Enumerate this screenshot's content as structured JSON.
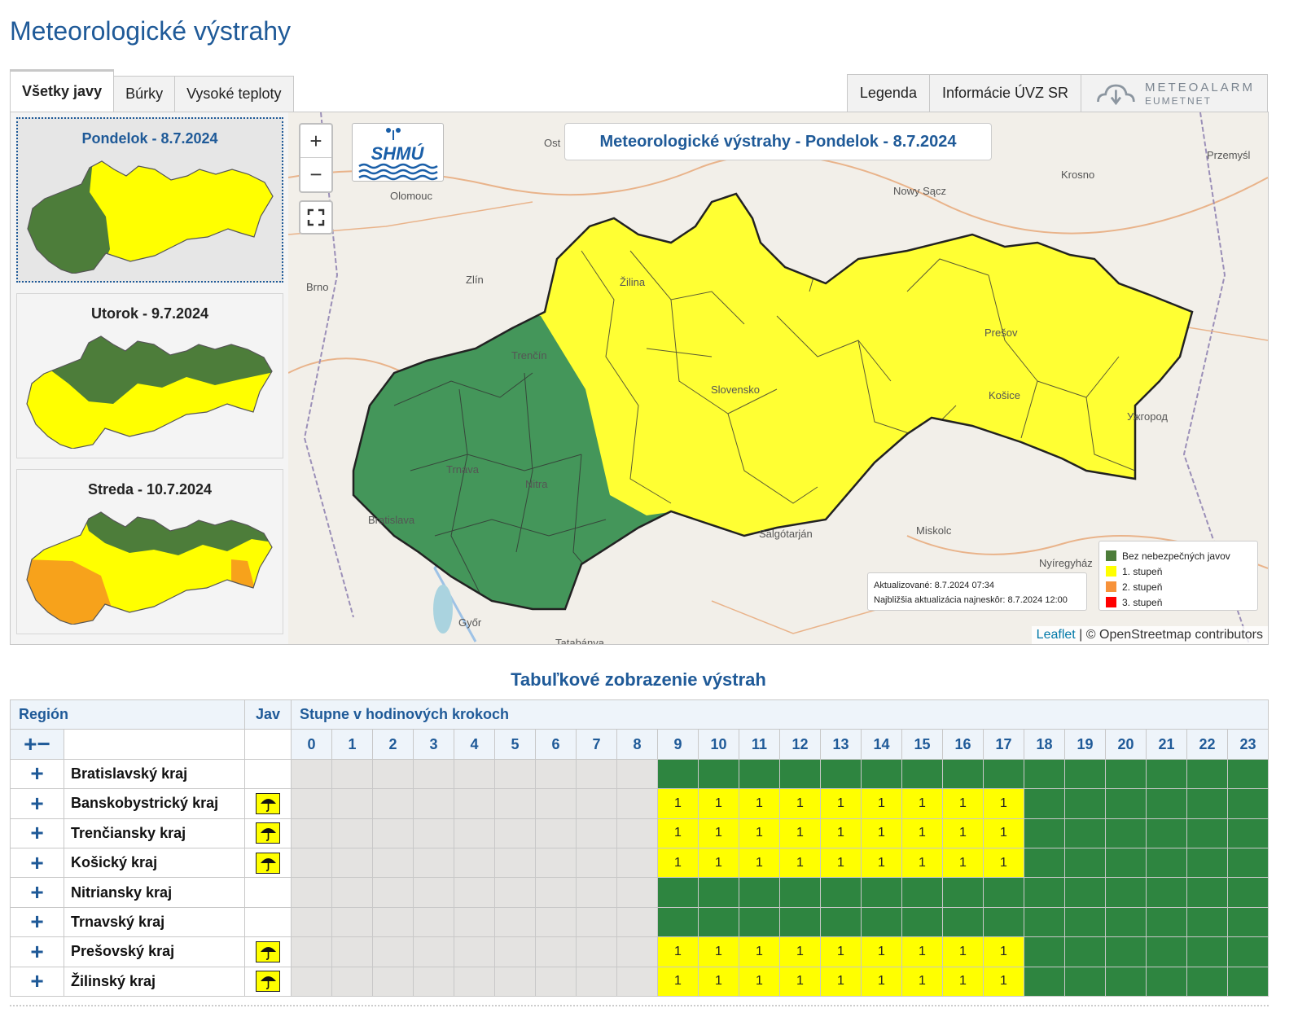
{
  "page": {
    "title": "Meteorologické výstrahy"
  },
  "tabs": [
    {
      "label": "Všetky javy",
      "active": true
    },
    {
      "label": "Búrky",
      "active": false
    },
    {
      "label": "Vysoké teploty",
      "active": false
    }
  ],
  "right_tabs": {
    "legend": "Legenda",
    "info": "Informácie ÚVZ SR",
    "meteoalarm_1": "METEOALARM",
    "meteoalarm_2": "EUMETNET"
  },
  "days": [
    {
      "label": "Pondelok - 8.7.2024",
      "selected": true
    },
    {
      "label": "Utorok - 9.7.2024",
      "selected": false
    },
    {
      "label": "Streda - 10.7.2024",
      "selected": false
    }
  ],
  "map": {
    "title": "Meteorologické výstrahy - Pondelok - 8.7.2024",
    "logo_text": "SHMÚ",
    "zoom_in": "+",
    "zoom_out": "−",
    "updated": "Aktualizované: 8.7.2024 07:34",
    "next_update": "Najbližšia aktualizácia najneskôr: 8.7.2024 12:00",
    "attribution_leaflet": "Leaflet",
    "attribution_rest": " | © OpenStreetmap contributors",
    "places": [
      "Olomouc",
      "Zlín",
      "Brno",
      "Trenčín",
      "Žilina",
      "Trnava",
      "Nitra",
      "Bratislava",
      "Slovensko",
      "Prešov",
      "Košice",
      "Ужгород",
      "Nowy Sącz",
      "Krosno",
      "Przemyśl",
      "Salgótarján",
      "Miskolc",
      "Nyíregyház",
      "Győr",
      "Tatabánya",
      "Ost"
    ]
  },
  "legend": [
    {
      "label": "Bez nebezpečných javov",
      "color": "#2e8540"
    },
    {
      "label": "1. stupeň",
      "color": "#ffff00"
    },
    {
      "label": "2. stupeň",
      "color": "#f7923a"
    },
    {
      "label": "3. stupeň",
      "color": "#ff0000"
    }
  ],
  "table": {
    "title": "Tabuľkové zobrazenie výstrah",
    "col_region": "Región",
    "col_jav": "Jav",
    "col_steps": "Stupne v hodinových krokoch",
    "expand_collapse": "+−",
    "hours": [
      "0",
      "1",
      "2",
      "3",
      "4",
      "5",
      "6",
      "7",
      "8",
      "9",
      "10",
      "11",
      "12",
      "13",
      "14",
      "15",
      "16",
      "17",
      "18",
      "19",
      "20",
      "21",
      "22",
      "23"
    ],
    "rows": [
      {
        "region": "Bratislavský kraj",
        "jav": false,
        "level": 0
      },
      {
        "region": "Banskobystrický kraj",
        "jav": true,
        "level": 1
      },
      {
        "region": "Trenčiansky kraj",
        "jav": true,
        "level": 1
      },
      {
        "region": "Košický kraj",
        "jav": true,
        "level": 1
      },
      {
        "region": "Nitriansky kraj",
        "jav": false,
        "level": 0
      },
      {
        "region": "Trnavský kraj",
        "jav": false,
        "level": 0
      },
      {
        "region": "Prešovský kraj",
        "jav": true,
        "level": 1
      },
      {
        "region": "Žilinský kraj",
        "jav": true,
        "level": 1
      }
    ],
    "grey_hours": 9,
    "yellow_until_hour": 17,
    "level_label": "1",
    "row_plus": "+"
  },
  "colors": {
    "accent": "#1f5a98",
    "green": "#2e8540",
    "yellow": "#ffff00",
    "orange": "#f7a21b",
    "grey": "#e4e3e1"
  },
  "icons": [
    "plus-icon",
    "minus-icon",
    "fullscreen-icon",
    "umbrella-icon",
    "meteoalarm-logo-icon",
    "shmu-logo"
  ]
}
